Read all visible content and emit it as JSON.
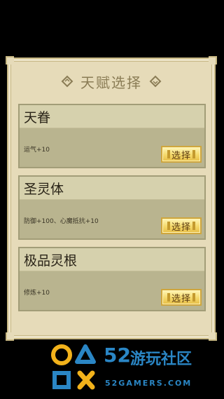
{
  "dialog": {
    "title": "天赋选择"
  },
  "talents": [
    {
      "name": "天眷",
      "desc": "运气+10",
      "button": "选择"
    },
    {
      "name": "圣灵体",
      "desc": "防御+100、心魔抵抗+10",
      "button": "选择"
    },
    {
      "name": "极品灵根",
      "desc": "修炼+10",
      "button": "选择"
    }
  ],
  "watermark": {
    "number": "52",
    "text": "游玩社区",
    "url": "52GAMERS.COM"
  },
  "colors": {
    "panel": "#e6dbb9",
    "card": "#b9b48f",
    "button": "#f4d86a",
    "watermark": "#2a86c5"
  }
}
